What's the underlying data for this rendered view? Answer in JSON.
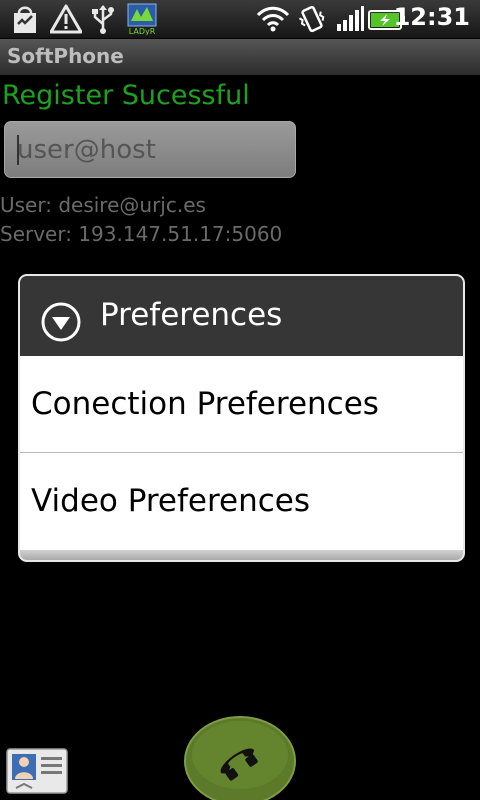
{
  "status_bar": {
    "time": "12:31",
    "icons": [
      "shopping-bag-icon",
      "warning-icon",
      "usb-icon",
      "ladyr-app-icon",
      "wifi-icon",
      "vibrate-icon",
      "signal-icon",
      "battery-charging-icon"
    ],
    "ladyr_label": "LADyR",
    "accent_color": "#7ad93a"
  },
  "app": {
    "title": "SoftPhone"
  },
  "main": {
    "status_message": "Register Sucessful",
    "status_color": "#1ea11e",
    "address_input": {
      "value": "",
      "placeholder": "user@host"
    },
    "user_line": "User: desire@urjc.es",
    "server_line": "Server: 193.147.51.17:5060"
  },
  "dialog": {
    "title": "Preferences",
    "items": [
      {
        "label": "Conection Preferences"
      },
      {
        "label": "Video Preferences"
      }
    ]
  },
  "bottom": {
    "icons": [
      "contacts-icon",
      "phone-handset-icon"
    ],
    "call_color": "#5d7a2a"
  }
}
